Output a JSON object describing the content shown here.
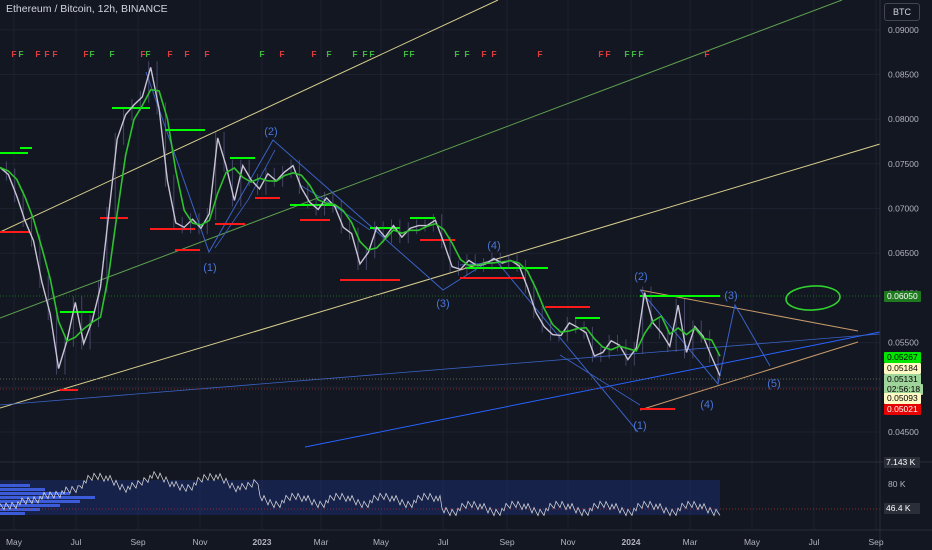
{
  "header": {
    "title": "Ethereum / Bitcoin, 12h, BINANCE",
    "currency_button": "BTC"
  },
  "chart_data": {
    "type": "line",
    "title": "Ethereum / Bitcoin, 12h, BINANCE",
    "ylim": [
      0.0441,
      0.0911
    ],
    "x_ticks": [
      "May",
      "Jul",
      "Sep",
      "Nov",
      "2023",
      "Mar",
      "May",
      "Jul",
      "Sep",
      "Nov",
      "2024",
      "Mar",
      "May",
      "Jul",
      "Sep"
    ],
    "y_ticks": [
      "0.09000",
      "0.08500",
      "0.08000",
      "0.07500",
      "0.07000",
      "0.06500",
      "0.06050",
      "0.05500",
      "0.05000",
      "0.04500"
    ],
    "series": [
      {
        "values": [
          0.0746,
          0.0738,
          0.0714,
          0.0686,
          0.0664,
          0.0618,
          0.0582,
          0.0521,
          0.0552,
          0.0595,
          0.0549,
          0.0574,
          0.0612,
          0.0695,
          0.0778,
          0.0805,
          0.0816,
          0.0825,
          0.0858,
          0.0812,
          0.0731,
          0.0684,
          0.0679,
          0.0688,
          0.0678,
          0.0694,
          0.0779,
          0.0748,
          0.0709,
          0.0748,
          0.0732,
          0.0722,
          0.0739,
          0.0731,
          0.0741,
          0.0748,
          0.0723,
          0.0707,
          0.0699,
          0.0712,
          0.0702,
          0.0679,
          0.0672,
          0.0638,
          0.0651,
          0.0679,
          0.0668,
          0.0681,
          0.0668,
          0.0678,
          0.0681,
          0.0681,
          0.0687,
          0.0662,
          0.0635,
          0.0632,
          0.0642,
          0.0636,
          0.0638,
          0.0644,
          0.0639,
          0.0642,
          0.0636,
          0.0612,
          0.0584,
          0.0568,
          0.0559,
          0.0558,
          0.0572,
          0.0567,
          0.0561,
          0.0535,
          0.0539,
          0.0552,
          0.0547,
          0.0531,
          0.0544,
          0.0606,
          0.0572,
          0.0561,
          0.0546,
          0.0592,
          0.0539,
          0.0568,
          0.0557,
          0.0534,
          0.0513
        ]
      }
    ],
    "price_tags": [
      {
        "label": "0.06050",
        "bg": "#1f7a1f",
        "fg": "#ffffff"
      },
      {
        "label": "0.05267",
        "bg": "#00e600",
        "fg": "#000000"
      },
      {
        "label": "0.05184",
        "bg": "#fff9c4",
        "fg": "#000000"
      },
      {
        "label": "0.05131",
        "bg": "#9fd49a",
        "fg": "#000000"
      },
      {
        "label": "02:56:18",
        "bg": "#9fd49a",
        "fg": "#000000"
      },
      {
        "label": "0.05093",
        "bg": "#fff9c4",
        "fg": "#000000"
      },
      {
        "label": "0.05021",
        "bg": "#e60000",
        "fg": "#ffffff"
      }
    ],
    "wave_labels": [
      "(1)",
      "(2)",
      "(3)",
      "(4)",
      "(2)",
      "(4)",
      "(1)",
      "(3)",
      "(5)"
    ],
    "fractal_markers": [
      "F"
    ],
    "volume_pane": {
      "y_ticks": [
        "7.143 K",
        "80 K",
        "46.4 K"
      ]
    },
    "colors": {
      "background": "#131722",
      "price": "#c9c3d6",
      "ma": "#2ec22e",
      "support": "#00ff00",
      "resistance": "#ff1a1a",
      "elliott": "#3a62c6",
      "channel_yellow": "#d8cf8c",
      "channel_green": "#5e9e4e",
      "triangle": "#c79a6a",
      "fractal_up": "#3fb93f",
      "fractal_down": "#e03c3c"
    }
  }
}
